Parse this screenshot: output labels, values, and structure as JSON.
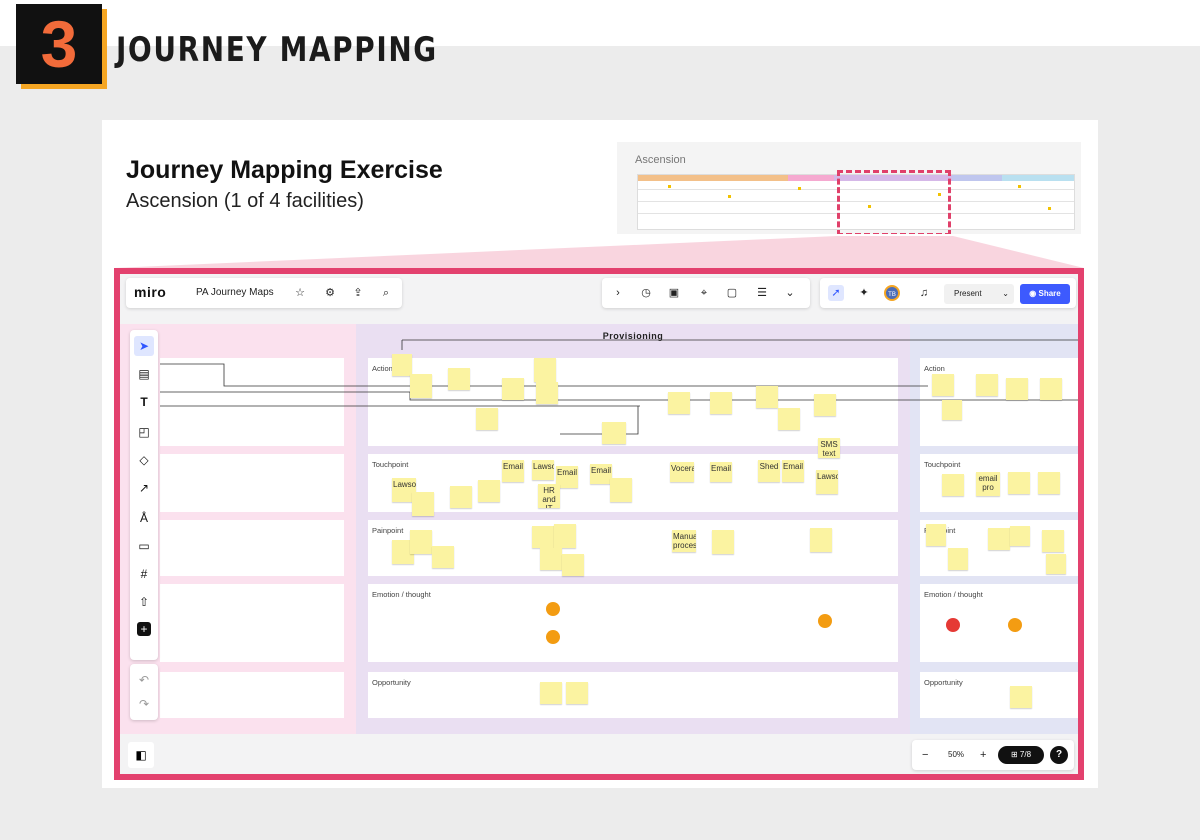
{
  "header": {
    "number": "3",
    "title": "JOURNEY MAPPING"
  },
  "card": {
    "title": "Journey Mapping Exercise",
    "subtitle": "Ascension (1 of 4 facilities)"
  },
  "thumbnail": {
    "label": "Ascension"
  },
  "miro": {
    "logo": "miro",
    "board_name": "PA Journey Maps",
    "icons": {
      "star": "star-icon",
      "settings": "gear-icon",
      "upload": "upload-icon",
      "search": "search-icon",
      "chevron": "chevron-right-icon",
      "timer": "timer-icon",
      "note": "card-icon",
      "focus": "focus-icon",
      "vote": "vote-icon",
      "notes": "document-icon",
      "more": "chevrons-down-icon",
      "cursor": "cursor-icon",
      "reactions": "celebrate-icon",
      "bell": "bell-icon"
    },
    "avatar_initials": "TB",
    "present_label": "Present",
    "share_label": "Share",
    "tools": [
      "select",
      "frame",
      "text",
      "sticky-note",
      "shapes",
      "connector",
      "pen",
      "comment",
      "frame-grid",
      "upload",
      "add"
    ],
    "zoom": "50%",
    "page": "7/8",
    "help": "?"
  },
  "board": {
    "lanes": [
      {
        "title": "",
        "color": "#f0a8cf"
      },
      {
        "title": "Provisioning",
        "color": "#cdb4e0"
      },
      {
        "title": "",
        "color": "#bcc3e8"
      }
    ],
    "rows": [
      "Action",
      "Touchpoint",
      "Painpoint",
      "Emotion / thought",
      "Opportunity"
    ],
    "rows_right": [
      "Action",
      "Touchpoint",
      "Painpoint",
      "Emotion / thought",
      "Opportunity"
    ],
    "stickies": [
      {
        "text": "Lawson"
      },
      {
        "text": "Email"
      },
      {
        "text": "Lawson"
      },
      {
        "text": "Email"
      },
      {
        "text": "HR and IT"
      },
      {
        "text": "Email"
      },
      {
        "text": "Vocera"
      },
      {
        "text": "Email"
      },
      {
        "text": "Shed"
      },
      {
        "text": "Email"
      },
      {
        "text": "SMS text"
      },
      {
        "text": "Lawson"
      },
      {
        "text": "email pro"
      },
      {
        "text": "Manual process"
      }
    ]
  }
}
